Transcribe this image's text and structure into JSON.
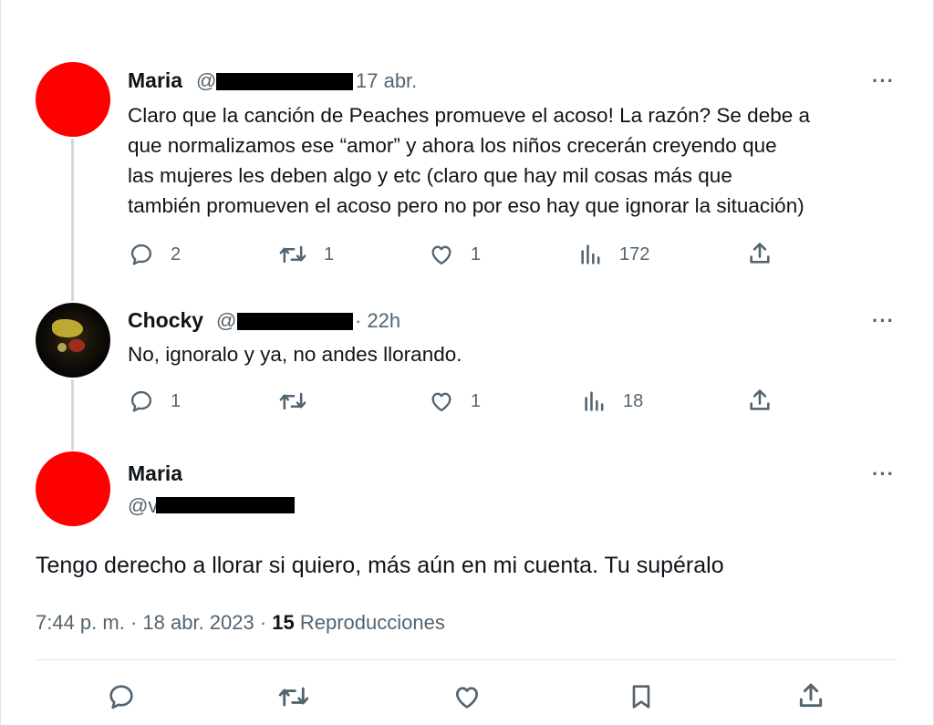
{
  "thread": {
    "reply1": {
      "name": "Maria",
      "handle_prefix": "@",
      "time": "17 abr.",
      "more": "···",
      "lines": [
        "Claro que la canción de Peaches promueve el acoso! La razón? Se debe a",
        "que normalizamos ese “amor” y ahora los niños crecerán creyendo que",
        "las mujeres les deben algo y etc (claro que hay mil cosas más que",
        "también promueven el acoso pero no por eso hay que ignorar la situación)"
      ],
      "replies": "2",
      "retweets": "1",
      "likes": "1",
      "views": "172",
      "avatar_color": "#ff0000"
    },
    "reply2": {
      "name": "Chocky",
      "handle_prefix": "@",
      "time": "· 22h",
      "more": "···",
      "lines": [
        "No, ignoralo y ya, no andes llorando."
      ],
      "replies": "1",
      "retweets": "",
      "likes": "1",
      "views": "18"
    },
    "main": {
      "name": "Maria",
      "handle_prefix": "@v",
      "more": "···",
      "text": "Tengo derecho a llorar si quiero, más aún en mi cuenta. Tu supéralo",
      "time_date": "7:44 p. m. · 18 abr. 2023 · ",
      "views_count": "15",
      "views_label": " Reproducciones",
      "avatar_color": "#ff0000"
    }
  },
  "icons": [
    "reply-icon",
    "retweet-icon",
    "like-icon",
    "views-icon",
    "share-icon",
    "bookmark-icon"
  ]
}
